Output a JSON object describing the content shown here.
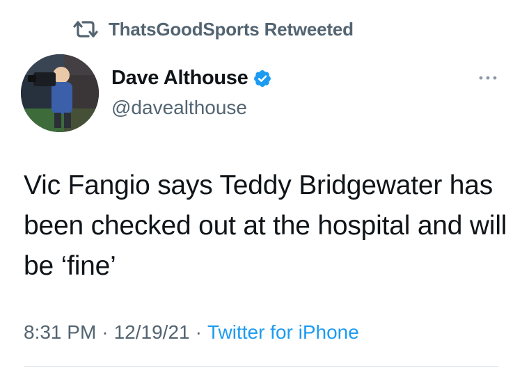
{
  "retweet": {
    "icon": "retweet-icon",
    "text": "ThatsGoodSports Retweeted"
  },
  "author": {
    "display_name": "Dave Althouse",
    "handle": "@davealthouse",
    "verified": true,
    "verified_icon": "verified-badge-icon",
    "avatar_icon": "avatar"
  },
  "more_icon": "more-options-icon",
  "tweet": {
    "text": "Vic Fangio says Teddy Bridgewater has been checked out at the hospital and will be ‘fine’"
  },
  "meta": {
    "time": "8:31 PM",
    "sep1": "·",
    "date": "12/19/21",
    "sep2": "·",
    "source": "Twitter for iPhone"
  },
  "colors": {
    "text_primary": "#0f1419",
    "text_secondary": "#536471",
    "accent": "#1d9bf0",
    "divider": "#cfd9de"
  }
}
